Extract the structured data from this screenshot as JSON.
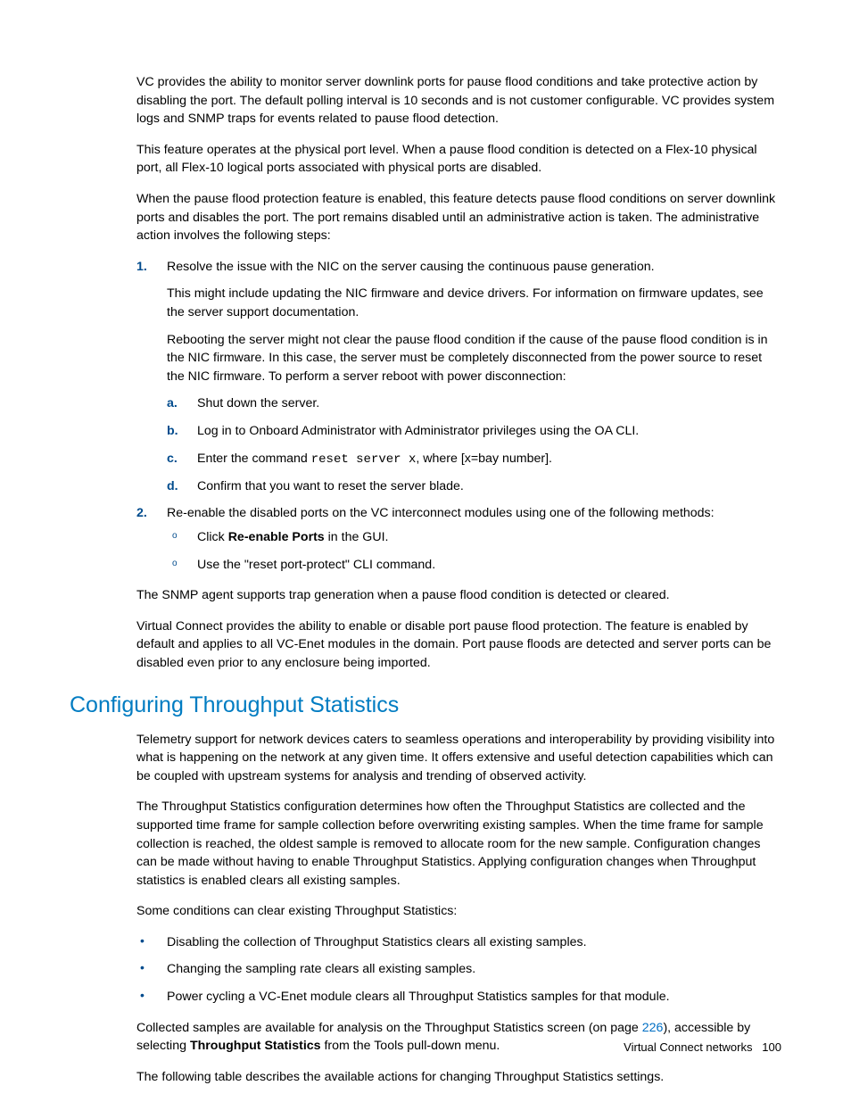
{
  "p1": "VC provides the ability to monitor server downlink ports for pause flood conditions and take protective action by disabling the port. The default polling interval is 10 seconds and is not customer configurable. VC provides system logs and SNMP traps for events related to pause flood detection.",
  "p2": "This feature operates at the physical port level. When a pause flood condition is detected on a Flex-10 physical port, all Flex-10 logical ports associated with physical ports are disabled.",
  "p3": "When the pause flood protection feature is enabled, this feature detects pause flood conditions on server downlink ports and disables the port. The port remains disabled until an administrative action is taken. The administrative action involves the following steps:",
  "step1_text": "Resolve the issue with the NIC on the server causing the continuous pause generation.",
  "step1_p1": "This might include updating the NIC firmware and device drivers. For information on firmware updates, see the server support documentation.",
  "step1_p2": "Rebooting the server might not clear the pause flood condition if the cause of the pause flood condition is in the NIC firmware. In this case, the server must be completely disconnected from the power source to reset the NIC firmware. To perform a server reboot with power disconnection:",
  "sub_a": "Shut down the server.",
  "sub_b": "Log in to Onboard Administrator with Administrator privileges using the OA CLI.",
  "sub_c_pre": "Enter the command ",
  "sub_c_code": "reset server x",
  "sub_c_post": ", where [x=bay number].",
  "sub_d": "Confirm that you want to reset the server blade.",
  "step2_text": "Re-enable the disabled ports on the VC interconnect modules using one of the following methods:",
  "step2_o1_pre": "Click ",
  "step2_o1_bold": "Re-enable Ports",
  "step2_o1_post": " in the GUI.",
  "step2_o2": "Use the \"reset port-protect\" CLI command.",
  "p4": "The SNMP agent supports trap generation when a pause flood condition is detected or cleared.",
  "p5": "Virtual Connect provides the ability to enable or disable port pause flood protection. The feature is enabled by default and applies to all VC-Enet modules in the domain. Port pause floods are detected and server ports can be disabled even prior to any enclosure being imported.",
  "heading": "Configuring Throughput Statistics",
  "tp1": "Telemetry support for network devices caters to seamless operations and interoperability by providing visibility into what is happening on the network at any given time. It offers extensive and useful detection capabilities which can be coupled with upstream systems for analysis and trending of observed activity.",
  "tp2": "The Throughput Statistics configuration determines how often the Throughput Statistics are collected and the supported time frame for sample collection before overwriting existing samples. When the time frame for sample collection is reached, the oldest sample is removed to allocate room for the new sample. Configuration changes can be made without having to enable Throughput Statistics. Applying configuration changes when Throughput statistics is enabled clears all existing samples.",
  "tp3": "Some conditions can clear existing Throughput Statistics:",
  "tb1": "Disabling the collection of Throughput Statistics clears all existing samples.",
  "tb2": "Changing the sampling rate clears all existing samples.",
  "tb3": "Power cycling a VC-Enet module clears all Throughput Statistics samples for that module.",
  "tp4_pre": "Collected samples are available for analysis on the Throughput Statistics screen (on page ",
  "tp4_link": "226",
  "tp4_mid": "), accessible by selecting ",
  "tp4_bold": "Throughput Statistics",
  "tp4_post": " from the Tools pull-down menu.",
  "tp5": "The following table describes the available actions for changing Throughput Statistics settings.",
  "footer_text": "Virtual Connect networks",
  "footer_page": "100",
  "markers": {
    "n1": "1.",
    "n2": "2.",
    "a": "a.",
    "b": "b.",
    "c": "c.",
    "d": "d.",
    "circ": "o",
    "bullet": "•"
  }
}
